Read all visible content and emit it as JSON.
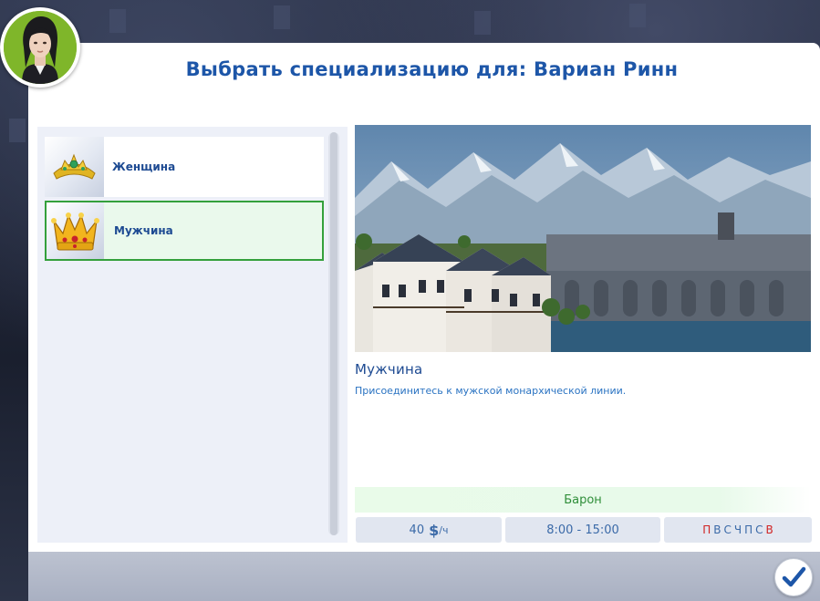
{
  "dialog": {
    "title": "Выбрать специализацию для: Вариан Ринн"
  },
  "specializations": [
    {
      "label": "Женщина",
      "icon": "tiara-icon",
      "selected": false
    },
    {
      "label": "Мужчина",
      "icon": "crown-icon",
      "selected": true
    }
  ],
  "details": {
    "title": "Мужчина",
    "description": "Присоединитесь к мужской монархической линии.",
    "rank": "Барон",
    "pay_amount": "40",
    "pay_currency": "$",
    "pay_unit": "/ч",
    "hours": "8:00 - 15:00",
    "days": [
      {
        "letter": "П",
        "off": true
      },
      {
        "letter": "В",
        "off": false
      },
      {
        "letter": "С",
        "off": false
      },
      {
        "letter": "Ч",
        "off": false
      },
      {
        "letter": "П",
        "off": false
      },
      {
        "letter": "С",
        "off": false
      },
      {
        "letter": "В",
        "off": true
      }
    ]
  },
  "colors": {
    "title_blue": "#1d56a8",
    "selected_green": "#34a03c",
    "rank_green": "#2f8e3a",
    "day_off_red": "#d02424"
  },
  "icons": {
    "confirm": "checkmark-icon",
    "avatar": "sim-portrait"
  }
}
